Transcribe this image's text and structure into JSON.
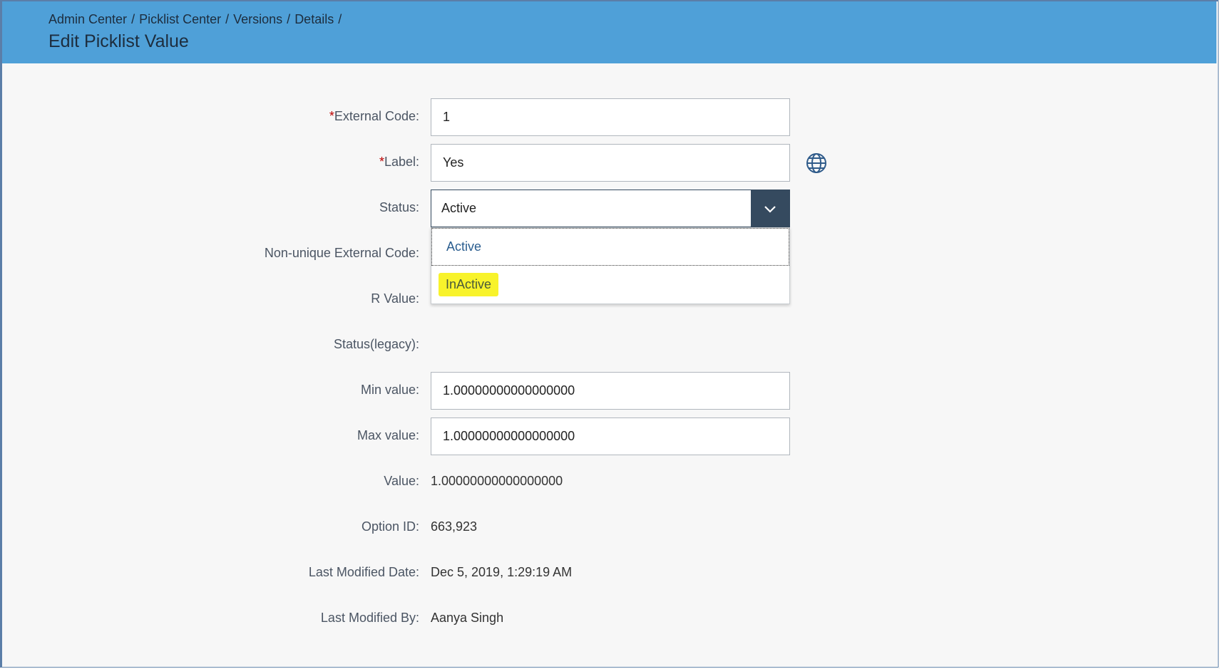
{
  "breadcrumb": [
    "Admin Center",
    "Picklist Center",
    "Versions",
    "Details"
  ],
  "breadcrumb_sep": "/",
  "page_title": "Edit Picklist Value",
  "form": {
    "external_code": {
      "label": "External Code:",
      "value": "1",
      "required": "*"
    },
    "label": {
      "label": "Label:",
      "value": "Yes",
      "required": "*"
    },
    "status": {
      "label": "Status:",
      "value": "Active",
      "options": [
        "Active",
        "InActive"
      ]
    },
    "non_unique_external_code": {
      "label": "Non-unique External Code:"
    },
    "r_value": {
      "label": "R Value:"
    },
    "status_legacy": {
      "label": "Status(legacy):"
    },
    "min_value": {
      "label": "Min value:",
      "value": "1.00000000000000000"
    },
    "max_value": {
      "label": "Max value:",
      "value": "1.00000000000000000"
    },
    "value": {
      "label": "Value:",
      "value": "1.00000000000000000"
    },
    "option_id": {
      "label": "Option ID:",
      "value": "663,923"
    },
    "last_modified_date": {
      "label": "Last Modified Date:",
      "value": "Dec 5, 2019, 1:29:19 AM"
    },
    "last_modified_by": {
      "label": "Last Modified By:",
      "value": "Aanya Singh"
    }
  },
  "icons": {
    "translate": "globe-icon",
    "dropdown": "chevron-down-icon"
  },
  "colors": {
    "header": "#4fa0d8",
    "select_button": "#354a5f",
    "highlight": "#f8f32b",
    "required": "#bb0000"
  }
}
